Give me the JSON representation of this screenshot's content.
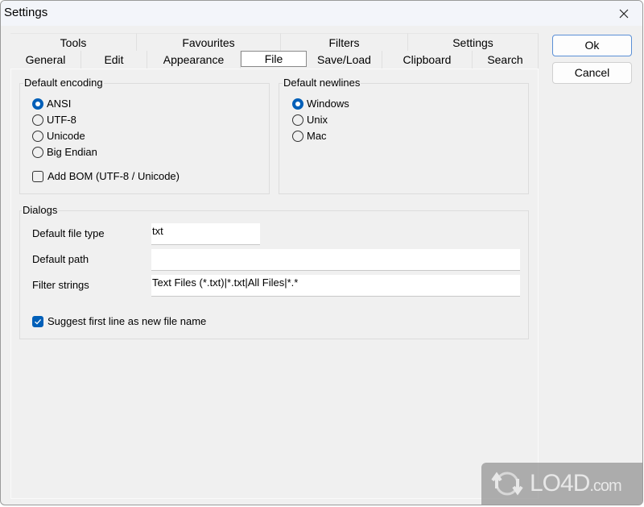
{
  "window": {
    "title": "Settings"
  },
  "tabs": {
    "back_row": [
      "Tools",
      "Favourites",
      "Filters",
      "Settings"
    ],
    "front_row": [
      "General",
      "Edit",
      "Appearance",
      "File",
      "Save/Load",
      "Clipboard",
      "Search"
    ],
    "active": "File"
  },
  "encoding": {
    "legend": "Default encoding",
    "options": [
      {
        "label": "ANSI",
        "checked": true
      },
      {
        "label": "UTF-8",
        "checked": false
      },
      {
        "label": "Unicode",
        "checked": false
      },
      {
        "label": "Big Endian",
        "checked": false
      }
    ],
    "bom_label": "Add BOM (UTF-8 / Unicode)",
    "bom_checked": false
  },
  "newlines": {
    "legend": "Default newlines",
    "options": [
      {
        "label": "Windows",
        "checked": true
      },
      {
        "label": "Unix",
        "checked": false
      },
      {
        "label": "Mac",
        "checked": false
      }
    ]
  },
  "dialogs": {
    "legend": "Dialogs",
    "default_file_type_label": "Default file type",
    "default_file_type_value": "txt",
    "default_path_label": "Default path",
    "default_path_value": "",
    "filter_strings_label": "Filter strings",
    "filter_strings_value": "Text Files (*.txt)|*.txt|All Files|*.*",
    "suggest_label": "Suggest first line as new file name",
    "suggest_checked": true
  },
  "buttons": {
    "ok": "Ok",
    "cancel": "Cancel"
  },
  "watermark": {
    "text": "LO4D",
    "suffix": ".com"
  },
  "colors": {
    "accent": "#005fb8",
    "window_bg": "#f0f0f0"
  }
}
